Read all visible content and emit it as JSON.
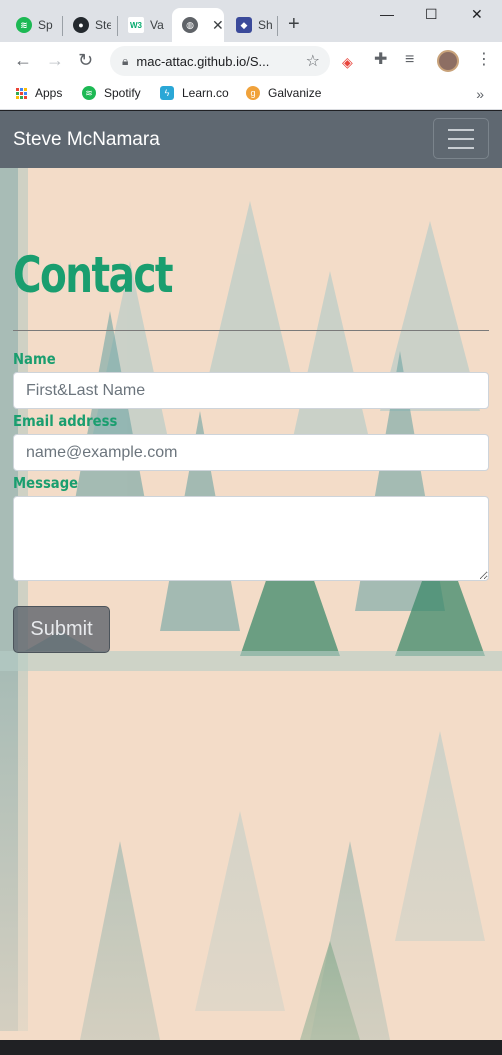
{
  "browser": {
    "tabs": [
      {
        "title": "Sp",
        "icon": "spotify-icon",
        "color": "#1db954"
      },
      {
        "title": "Ste",
        "icon": "github-icon",
        "color": "#24292e"
      },
      {
        "title": "Va",
        "icon": "w3schools-icon",
        "color": "#ffffff"
      },
      {
        "title": "",
        "icon": "globe-icon",
        "color": "#5f6368",
        "active": true
      },
      {
        "title": "Sh",
        "icon": "shield-icon",
        "color": "#3b4a9a"
      }
    ],
    "new_tab": "+",
    "url": "mac-attac.github.io/S...",
    "window_controls": {
      "minimize": "—",
      "maximize": "☐",
      "close": "✕"
    }
  },
  "bookmarks": [
    {
      "label": "Apps",
      "icon": "apps-grid-icon"
    },
    {
      "label": "Spotify",
      "icon": "spotify-icon",
      "color": "#1db954"
    },
    {
      "label": "Learn.co",
      "icon": "learn-icon",
      "color": "#2aa7d6"
    },
    {
      "label": "Galvanize",
      "icon": "galvanize-icon",
      "color": "#f0a23b"
    }
  ],
  "bookmarks_more": "»",
  "navbar": {
    "brand": "Steve McNamara"
  },
  "contact": {
    "heading": "Contact",
    "name_label": "Name",
    "name_placeholder": "First&Last Name",
    "email_label": "Email address",
    "email_placeholder": "name@example.com",
    "message_label": "Message",
    "submit_label": "Submit"
  },
  "colors": {
    "accent": "#1a9e6f",
    "navbar": "#5f6871",
    "page_bg": "#f3dcc8"
  }
}
